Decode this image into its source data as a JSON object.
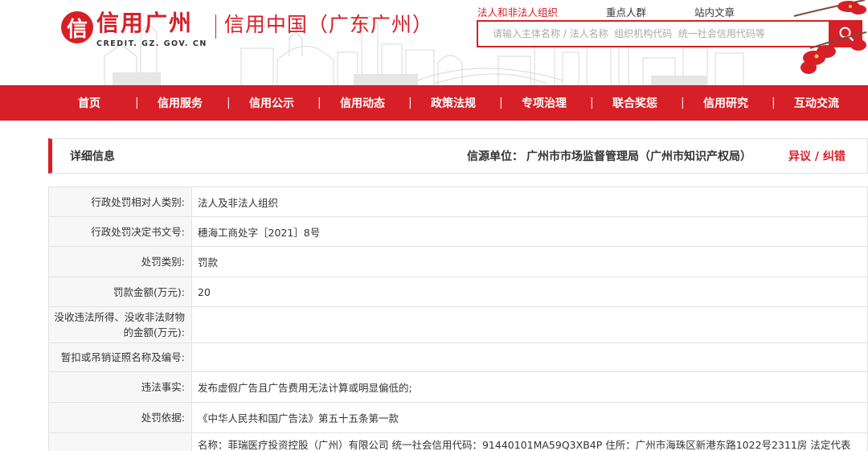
{
  "header": {
    "logo_mark": "信",
    "logo_main": "信用广州",
    "logo_sub": "CREDIT. GZ. GOV. CN",
    "region": "信用中国（广东广州）",
    "search_tabs": [
      {
        "label": "法人和非法人组织",
        "active": true
      },
      {
        "label": "重点人群",
        "active": false
      },
      {
        "label": "站内文章",
        "active": false
      }
    ],
    "search_placeholder": "请输入主体名称 / 法人名称  组织机构代码  统一社会信用代码等",
    "search_icon": "search-icon"
  },
  "nav": {
    "items": [
      "首页",
      "信用服务",
      "信用公示",
      "信用动态",
      "政策法规",
      "专项治理",
      "联合奖惩",
      "信用研究",
      "互动交流"
    ],
    "separator": "|"
  },
  "detail": {
    "title": "详细信息",
    "source_label": "信源单位：",
    "source_value": "广州市市场监督管理局（广州市知识产权局）",
    "action": "异议 / 纠错"
  },
  "rows": [
    {
      "label": "行政处罚相对人类别:",
      "value": "法人及非法人组织"
    },
    {
      "label": "行政处罚决定书文号:",
      "value": "穗海工商处字［2021］8号"
    },
    {
      "label": "处罚类别:",
      "value": "罚款"
    },
    {
      "label": "罚款金额(万元):",
      "value": "20"
    },
    {
      "label": "没收违法所得、没收非法财物的金额(万元):",
      "value": ""
    },
    {
      "label": "暂扣或吊销证照名称及编号:",
      "value": ""
    },
    {
      "label": "违法事实:",
      "value": "发布虚假广告且广告费用无法计算或明显偏低的;"
    },
    {
      "label": "处罚依据:",
      "value": "《中华人民共和国广告法》第五十五条第一款"
    },
    {
      "label": "",
      "value": "名称：菲瑞医疗投资控股（广州）有限公司 统一社会信用代码：91440101MA59Q3XB4P 住所：广州市海珠区新港东路1022号2311房 法定代表"
    }
  ],
  "colors": {
    "brand_red": "#d61f26",
    "label_bg": "#f7f7f7",
    "border": "#e2e2e2"
  }
}
